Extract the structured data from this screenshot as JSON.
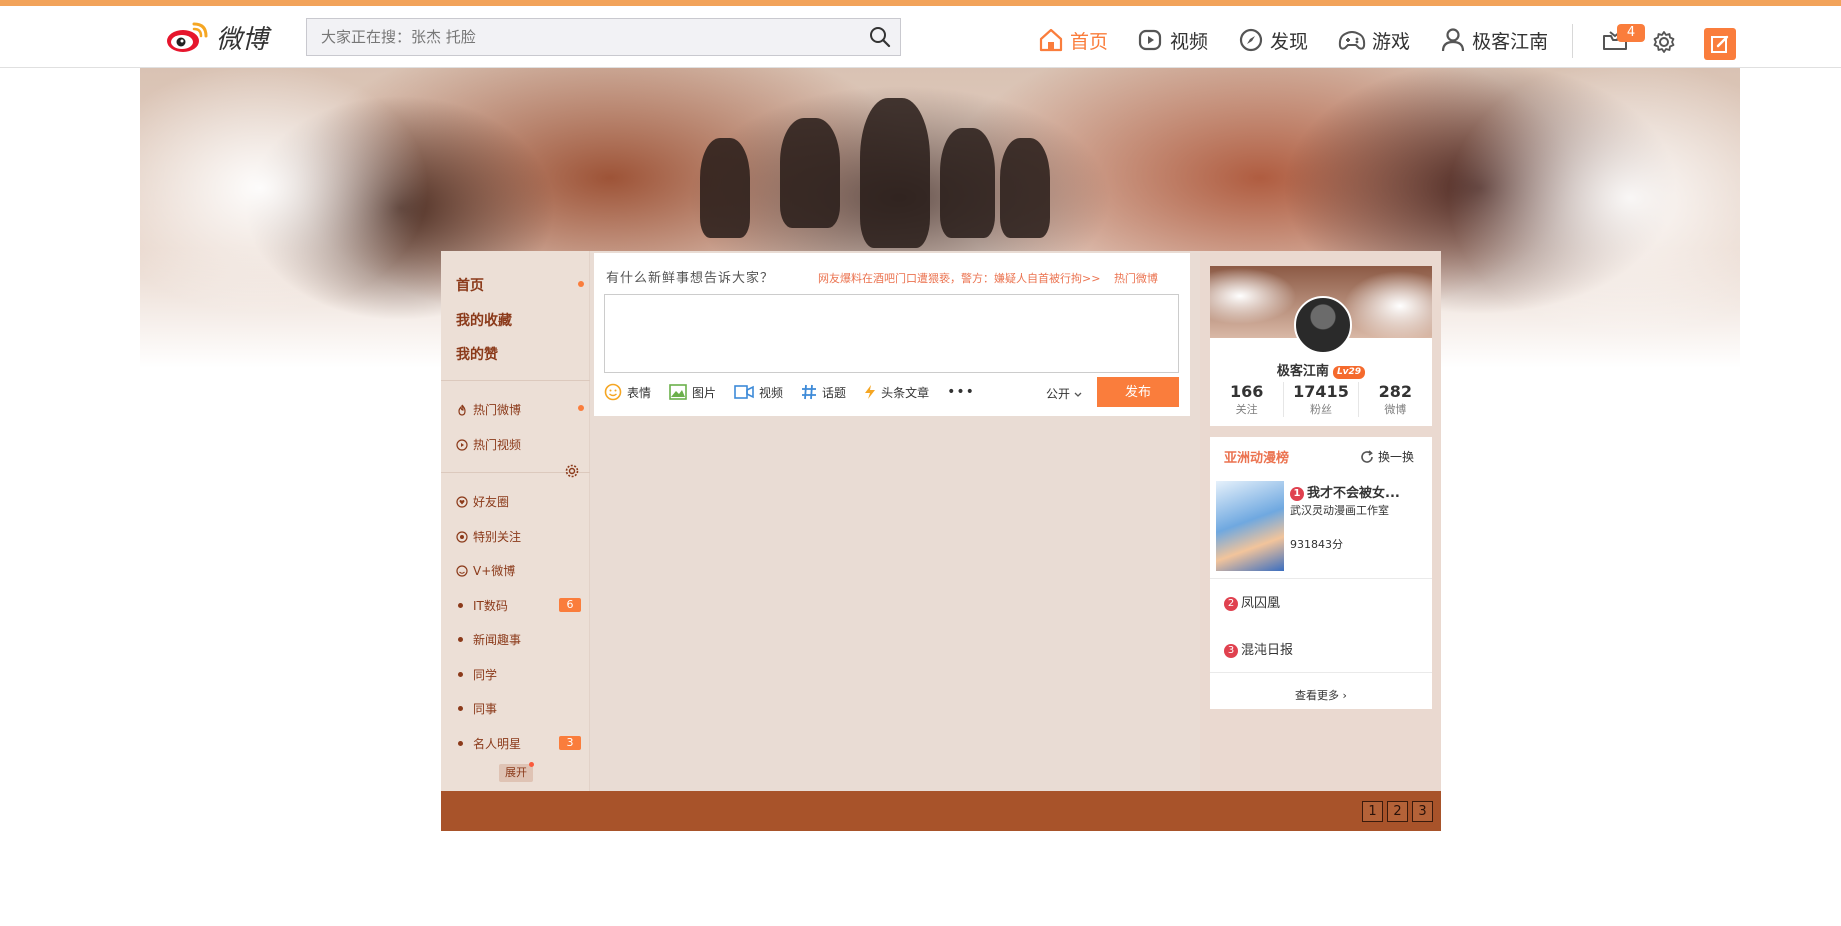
{
  "header": {
    "logo_text": "微博",
    "search_placeholder": "大家正在搜：张杰 托脸",
    "nav": [
      {
        "label": "首页",
        "icon": "home-icon",
        "active": true
      },
      {
        "label": "视频",
        "icon": "video-icon",
        "active": false
      },
      {
        "label": "发现",
        "icon": "compass-icon",
        "active": false
      },
      {
        "label": "游戏",
        "icon": "gamepad-icon",
        "active": false
      },
      {
        "label": "极客江南",
        "icon": "user-icon",
        "active": false
      }
    ],
    "mail_count": "4",
    "accent": "#fa7d3c"
  },
  "left_nav": {
    "primary": [
      "首页",
      "我的收藏",
      "我的赞"
    ],
    "hot": [
      "热门微博",
      "热门视频"
    ],
    "groups": [
      "好友圈",
      "特别关注",
      "V+微博"
    ],
    "lists": [
      {
        "label": "IT数码",
        "badge": "6"
      },
      {
        "label": "新闻趣事",
        "badge": ""
      },
      {
        "label": "同学",
        "badge": ""
      },
      {
        "label": "同事",
        "badge": ""
      },
      {
        "label": "名人明星",
        "badge": "3"
      }
    ],
    "expand": "展开"
  },
  "publish": {
    "title": "有什么新鲜事想告诉大家？",
    "hot_text": "网友爆料在酒吧门口遭猥亵，警方：嫌疑人自首被行拘>>",
    "hot_link": "热门微博",
    "tools": [
      "表情",
      "图片",
      "视频",
      "话题",
      "头条文章"
    ],
    "more": "•••",
    "visibility": "公开",
    "submit": "发布"
  },
  "profile": {
    "name": "极客江南",
    "level": "Lv29",
    "stats": [
      {
        "num": "166",
        "label": "关注"
      },
      {
        "num": "17415",
        "label": "粉丝"
      },
      {
        "num": "282",
        "label": "微博"
      }
    ]
  },
  "rank": {
    "title": "亚洲动漫榜",
    "refresh": "换一换",
    "items": [
      {
        "rank": "1",
        "title": "我才不会被女...",
        "sub": "武汉灵动漫画工作室",
        "score": "931843分"
      },
      {
        "rank": "2",
        "title": "凤囚凰"
      },
      {
        "rank": "3",
        "title": "混沌日报"
      }
    ],
    "more": "查看更多"
  },
  "pager": [
    "1",
    "2",
    "3"
  ]
}
